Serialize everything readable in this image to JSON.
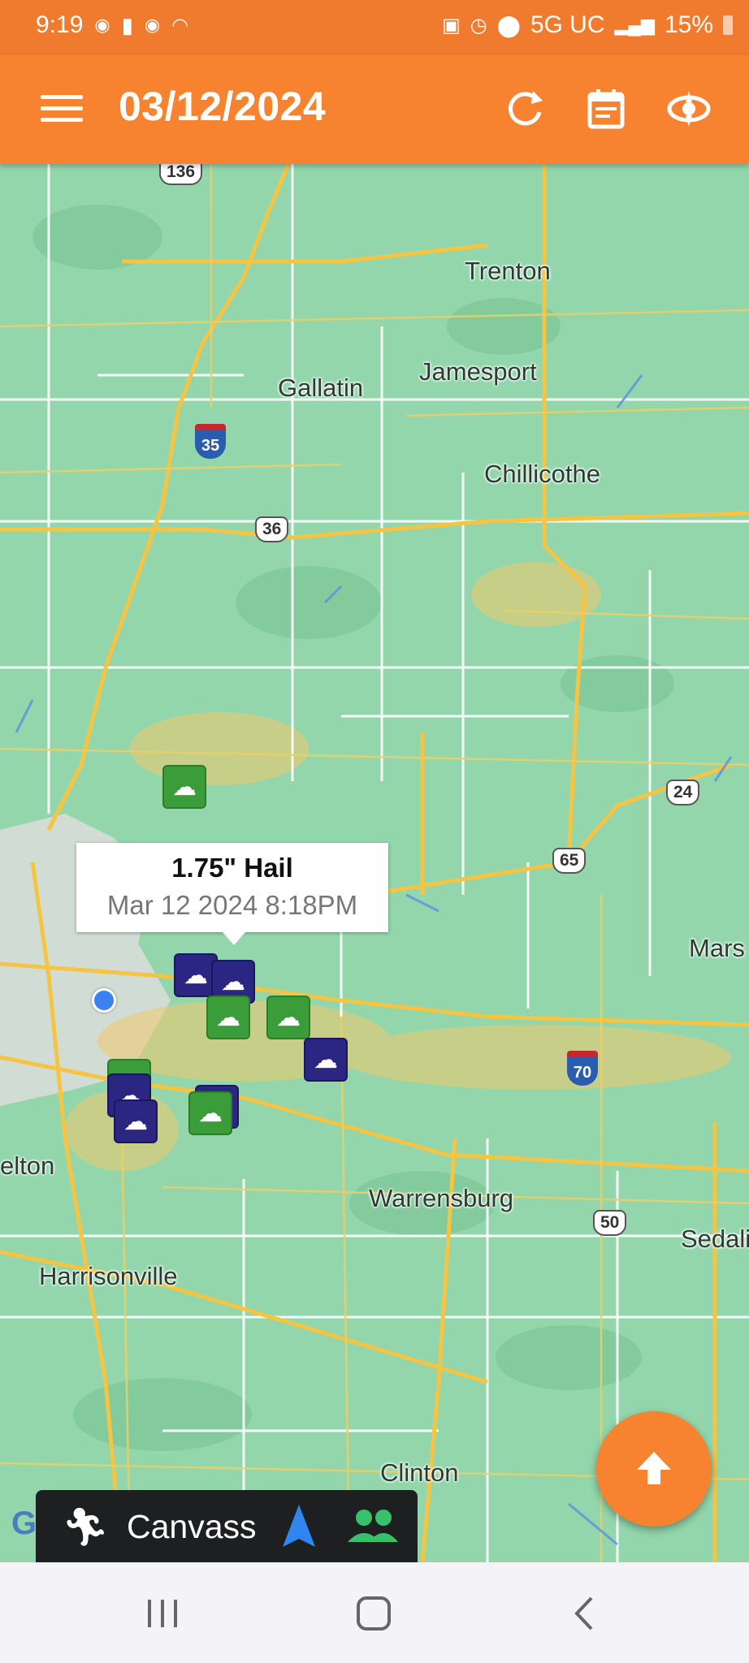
{
  "status_bar": {
    "time": "9:19",
    "network": "5G UC",
    "battery": "15%"
  },
  "app_bar": {
    "title": "03/12/2024",
    "menu_icon": "hamburger-menu-icon",
    "refresh_icon": "refresh-icon",
    "calendar_icon": "calendar-icon",
    "radar_icon": "storm-radar-icon"
  },
  "map": {
    "places": [
      {
        "name": "Trenton"
      },
      {
        "name": "Jamesport"
      },
      {
        "name": "Gallatin"
      },
      {
        "name": "Chillicothe"
      },
      {
        "name": "Mars"
      },
      {
        "name": "elton"
      },
      {
        "name": "Warrensburg"
      },
      {
        "name": "Sedali"
      },
      {
        "name": "Harrisonville"
      },
      {
        "name": "Clinton"
      }
    ],
    "road_shields": {
      "us_136": "136",
      "i_35": "35",
      "us_36": "36",
      "us_24": "24",
      "us_65": "65",
      "i_70": "70",
      "us_50": "50"
    },
    "tooltip": {
      "title": "1.75\" Hail",
      "subtitle": "Mar 12 2024  8:18PM"
    },
    "google_logo": "Google"
  },
  "canvass_bar": {
    "label": "Canvass",
    "walk_icon": "walking-person-icon",
    "navigate_icon": "navigation-arrow-icon",
    "team_icon": "group-icon"
  },
  "colors": {
    "accent": "#f7822f",
    "hail_marker": "#3a9d3a",
    "wind_marker": "#2a2682"
  }
}
